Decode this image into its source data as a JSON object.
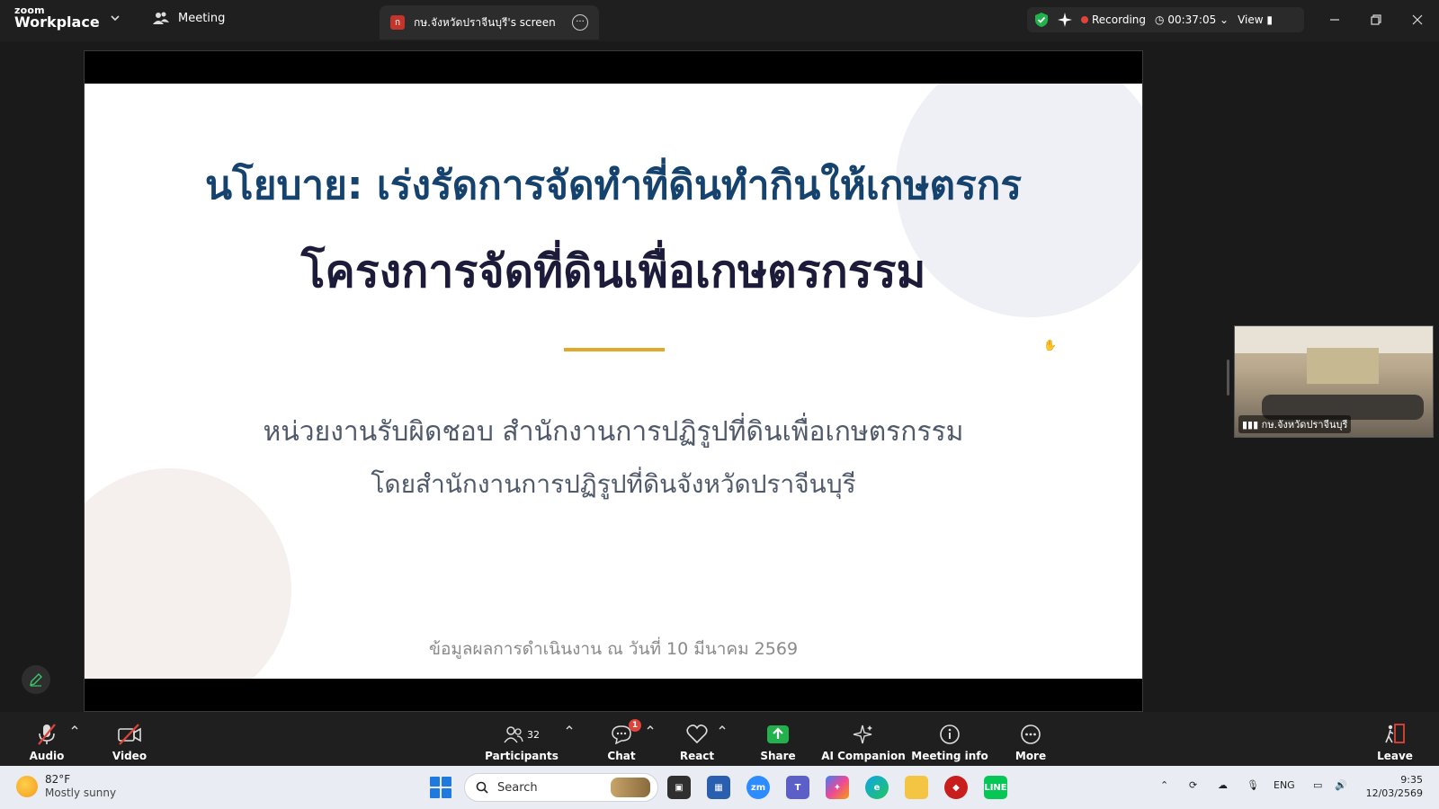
{
  "app": {
    "logo_top": "zoom",
    "logo_bottom": "Workplace",
    "meeting_label": "Meeting"
  },
  "share_tab": {
    "badge": "ก",
    "title": "กษ.จังหวัดปราจีนบุรี's screen"
  },
  "status": {
    "recording_label": "Recording",
    "elapsed": "00:37:05",
    "view_label": "View"
  },
  "slide": {
    "title_line1": "นโยบาย: เร่งรัดการจัดทำที่ดินทำกินให้เกษตรกร",
    "title_line2": "โครงการจัดที่ดินเพื่อเกษตรกรรม",
    "responsible": "หน่วยงานรับผิดชอบ  สำนักงานการปฏิรูปที่ดินเพื่อเกษตรกรรม",
    "by": "โดยสำนักงานการปฏิรูปที่ดินจังหวัดปราจีนบุรี",
    "footer": "ข้อมูลผลการดำเนินงาน ณ วันที่  10  มีนาคม 2569"
  },
  "thumbnail": {
    "label": "กษ.จังหวัดปราจีนบุรี"
  },
  "toolbar": {
    "audio": "Audio",
    "video": "Video",
    "participants": "Participants",
    "participants_count": "32",
    "chat": "Chat",
    "chat_badge": "1",
    "react": "React",
    "share": "Share",
    "ai_companion": "AI Companion",
    "meeting_info": "Meeting info",
    "more": "More",
    "leave": "Leave"
  },
  "taskbar": {
    "weather_temp": "82°F",
    "weather_desc": "Mostly sunny",
    "search_placeholder": "Search",
    "lang": "ENG",
    "time": "9:35",
    "date": "12/03/2569"
  },
  "colors": {
    "accent_blue": "#16436e",
    "gold_line": "#e3a82a",
    "recording_red": "#e0433a",
    "share_green": "#22b14c"
  }
}
